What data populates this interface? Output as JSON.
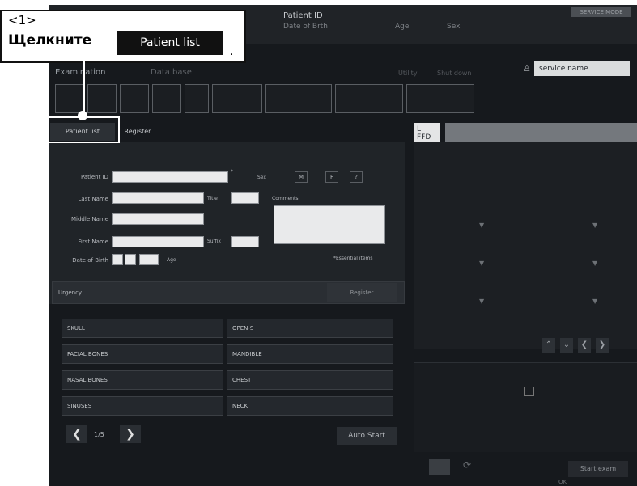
{
  "callout": {
    "number": "<1>",
    "text": "Щелкните",
    "button_label": "Patient list",
    "punct": "."
  },
  "header": {
    "patient_id_label": "Patient ID",
    "dob_label": "Date of Brth",
    "age_label": "Age",
    "sex_label": "Sex",
    "right_info": "SERVICE MODE"
  },
  "tabs": {
    "examination": "Examination",
    "database": "Data base",
    "utility": "Utility",
    "shut_down": "Shut down"
  },
  "service": {
    "name": "service name"
  },
  "subtabs": {
    "patient_list": "Patient list",
    "register": "Register"
  },
  "form": {
    "patient_id": "Patient ID",
    "last_name": "Last Name",
    "middle_name": "Middle Name",
    "first_name": "First Name",
    "dob": "Date of Birth",
    "sex": "Sex",
    "sex_m": "M",
    "sex_f": "F",
    "sex_o": "?",
    "title": "Title",
    "suffix": "Suffix",
    "comments": "Comments",
    "age": "Age",
    "essential": "*Essential items",
    "essential_mark": "*"
  },
  "actions": {
    "urgency": "Urgency",
    "register": "Register",
    "auto_start": "Auto Start",
    "start_exam": "Start exam",
    "ok": "OK"
  },
  "body_parts": [
    "SKULL",
    "OPEN-S",
    "FACIAL BONES",
    "MANDIBLE",
    "NASAL BONES",
    "CHEST",
    "SINUSES",
    "NECK"
  ],
  "pager": {
    "current": "1/5"
  },
  "rpanel": {
    "ffd": "FFD",
    "l_mark": "L"
  }
}
